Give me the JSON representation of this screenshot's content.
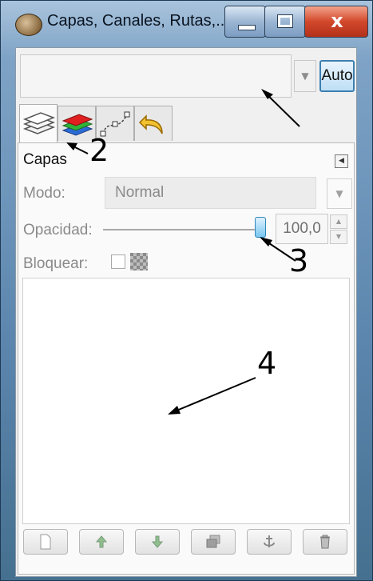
{
  "window": {
    "title": "Capas, Canales, Rutas,...",
    "controls": {
      "close": "x"
    }
  },
  "image_menu": {
    "value": "",
    "auto_label": "Auto"
  },
  "tabs": [
    {
      "name": "layers-tab",
      "icon": "layers-icon",
      "active": true
    },
    {
      "name": "channels-tab",
      "icon": "channels-icon",
      "active": false
    },
    {
      "name": "paths-tab",
      "icon": "paths-icon",
      "active": false
    },
    {
      "name": "undo-history-tab",
      "icon": "undo-icon",
      "active": false
    }
  ],
  "panel": {
    "title": "Capas",
    "mode_label": "Modo:",
    "mode_value": "Normal",
    "opacity_label": "Opacidad:",
    "opacity_value": "100,0",
    "opacity": 1.0,
    "lock_label": "Bloquear:"
  },
  "bottom_buttons": [
    {
      "name": "new-layer-button",
      "icon": "new-page-icon"
    },
    {
      "name": "raise-layer-button",
      "icon": "arrow-up-icon"
    },
    {
      "name": "lower-layer-button",
      "icon": "arrow-down-icon"
    },
    {
      "name": "duplicate-layer-button",
      "icon": "duplicate-icon"
    },
    {
      "name": "anchor-layer-button",
      "icon": "anchor-icon"
    },
    {
      "name": "delete-layer-button",
      "icon": "trash-icon"
    }
  ],
  "annotations": [
    "2",
    "3",
    "4"
  ]
}
